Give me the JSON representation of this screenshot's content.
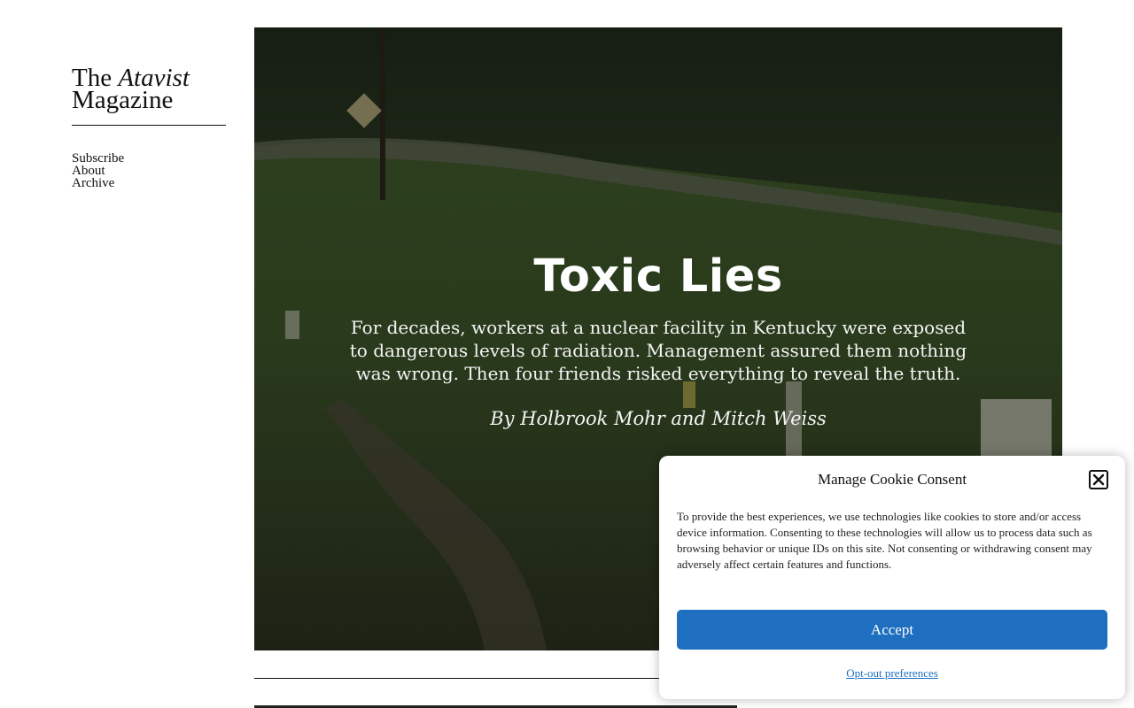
{
  "site": {
    "logo_the": "The",
    "logo_atavist": "Atavist",
    "logo_magazine": "Magazine"
  },
  "nav": {
    "items": [
      {
        "label": "Subscribe"
      },
      {
        "label": "About"
      },
      {
        "label": "Archive"
      }
    ]
  },
  "hero": {
    "title": "Toxic Lies",
    "dek": "For decades, workers at a nuclear facility in Kentucky were exposed to dangerous levels of radiation. Management assured them nothing was wrong. Then four friends risked everything to reveal the truth.",
    "byline": "By Holbrook Mohr and Mitch Weiss"
  },
  "cookie": {
    "title": "Manage Cookie Consent",
    "close_icon": "close-icon",
    "body": "To provide the best experiences, we use technologies like cookies to store and/or access device information. Consenting to these technologies will allow us to process data such as browsing behavior or unique IDs on this site. Not consenting or withdrawing consent may adversely affect certain features and functions.",
    "accept_label": "Accept",
    "optout_label": "Opt-out preferences",
    "accent_color": "#1e6fc0"
  }
}
